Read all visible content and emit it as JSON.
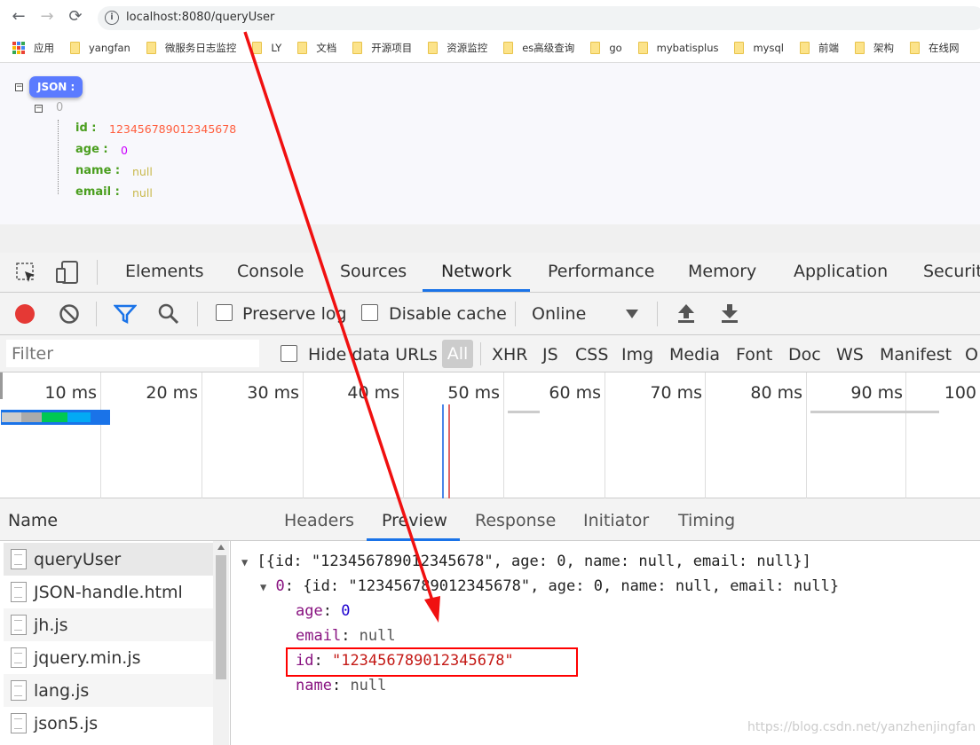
{
  "browser": {
    "url": "localhost:8080/queryUser",
    "nav": {
      "back": "←",
      "forward": "→",
      "reload": "⟳"
    }
  },
  "bookmarks": [
    "应用",
    "yangfan",
    "微服务日志监控",
    "LY",
    "文档",
    "开源项目",
    "资源监控",
    "es高级查询",
    "go",
    "mybatisplus",
    "mysql",
    "前端",
    "架构",
    "在线网"
  ],
  "json_view": {
    "badge": "JSON :",
    "index": "0",
    "fields": [
      {
        "key": "id :",
        "value": "123456789012345678",
        "color": "#ff5f3f"
      },
      {
        "key": "age :",
        "value": "0",
        "color": "#cc00ff"
      },
      {
        "key": "name :",
        "value": "null",
        "color": "#c8b84a"
      },
      {
        "key": "email :",
        "value": "null",
        "color": "#c8b84a"
      }
    ]
  },
  "devtools": {
    "tabs": [
      "Elements",
      "Console",
      "Sources",
      "Network",
      "Performance",
      "Memory",
      "Application",
      "Securit"
    ],
    "active_tab": "Network",
    "toolbar": {
      "preserve_log": "Preserve log",
      "disable_cache": "Disable cache",
      "throttle": "Online"
    },
    "filter": {
      "placeholder": "Filter",
      "hide_data_urls": "Hide data URLs",
      "types": [
        "All",
        "XHR",
        "JS",
        "CSS",
        "Img",
        "Media",
        "Font",
        "Doc",
        "WS",
        "Manifest",
        "O"
      ]
    },
    "timeline": {
      "ticks": [
        "10 ms",
        "20 ms",
        "30 ms",
        "40 ms",
        "50 ms",
        "60 ms",
        "70 ms",
        "80 ms",
        "90 ms",
        "100"
      ]
    },
    "name_header": "Name",
    "requests": [
      "queryUser",
      "JSON-handle.html",
      "jh.js",
      "jquery.min.js",
      "lang.js",
      "json5.js"
    ],
    "detail_tabs": [
      "Headers",
      "Preview",
      "Response",
      "Initiator",
      "Timing"
    ],
    "active_detail_tab": "Preview",
    "preview": {
      "line1": "[{id: \"123456789012345678\", age: 0, name: null, email: null}]",
      "line2_idx": "0",
      "line2": ": {id: \"123456789012345678\", age: 0, name: null, email: null}",
      "age_key": "age",
      "age_val": "0",
      "email_key": "email",
      "email_val": "null",
      "id_key": "id",
      "id_val": "\"123456789012345678\"",
      "name_key": "name",
      "name_val": "null"
    }
  },
  "watermark": "https://blog.csdn.net/yanzhenjingfan",
  "colors": {
    "accent": "#1a73e8",
    "annotation": "#ff0000",
    "record": "#e53935"
  }
}
